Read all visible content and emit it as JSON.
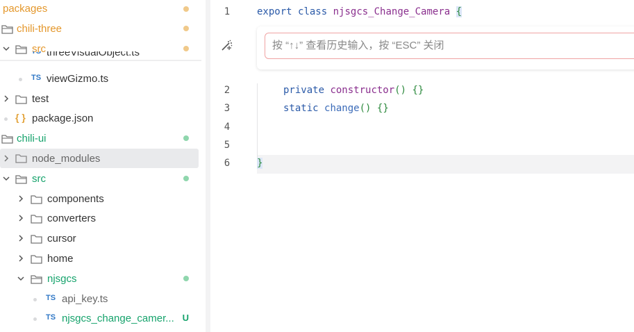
{
  "explorer": {
    "items": [
      {
        "label": "packages",
        "kind": "folder-root",
        "status": "orange"
      },
      {
        "label": "chili-three",
        "kind": "folder-open",
        "status": "orange"
      },
      {
        "label": "src",
        "kind": "folder-open",
        "status": "orange"
      },
      {
        "label": "threeVisualObject.ts",
        "kind": "ts"
      },
      {
        "label": "viewGizmo.ts",
        "kind": "ts"
      },
      {
        "label": "test",
        "kind": "folder-closed"
      },
      {
        "label": "package.json",
        "kind": "json"
      },
      {
        "label": "chili-ui",
        "kind": "folder-open",
        "status": "green"
      },
      {
        "label": "node_modules",
        "kind": "folder-closed",
        "selected": true
      },
      {
        "label": "src",
        "kind": "folder-open",
        "status": "green"
      },
      {
        "label": "components",
        "kind": "folder-closed"
      },
      {
        "label": "converters",
        "kind": "folder-closed"
      },
      {
        "label": "cursor",
        "kind": "folder-closed"
      },
      {
        "label": "home",
        "kind": "folder-closed"
      },
      {
        "label": "njsgcs",
        "kind": "folder-open",
        "status": "green"
      },
      {
        "label": "api_key.ts",
        "kind": "ts"
      },
      {
        "label": "njsgcs_change_camer...",
        "kind": "ts",
        "badge": "U"
      }
    ],
    "ts_icon": "TS",
    "json_icon": "{ }"
  },
  "editor": {
    "line_numbers": [
      "1",
      "2",
      "3",
      "4",
      "5",
      "6"
    ],
    "line1": {
      "export": "export",
      "class": "class",
      "name": "njsgcs_Change_Camera",
      "brace": "{"
    },
    "line2": {
      "private": "private",
      "ctor": "constructor",
      "parens": "()",
      "body": "{}"
    },
    "line3": {
      "static": "static",
      "method": "change",
      "parens": "()",
      "body": "{}"
    },
    "line6": {
      "brace": "}"
    }
  },
  "inline_chat": {
    "placeholder": "按 “↑↓” 查看历史输入，按 “ESC” 关闭"
  },
  "colors": {
    "accent_orange": "#e4972b",
    "accent_green": "#16a36c",
    "ts_blue": "#3178c6"
  }
}
